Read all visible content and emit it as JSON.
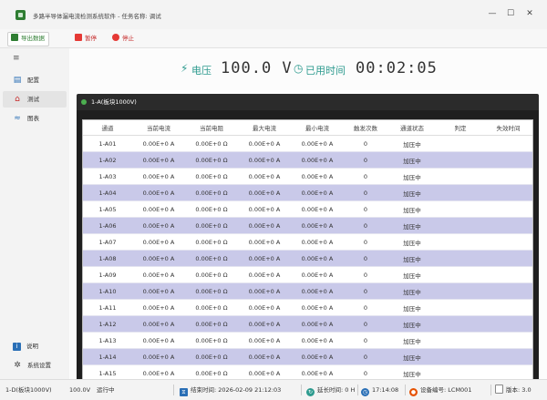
{
  "window": {
    "title": "多路半导体漏电流检测系统软件 - 任务名称: 调试",
    "minimize": "—",
    "maximize": "☐",
    "close": "✕"
  },
  "toolbar": {
    "export_label": "导出数据",
    "pause_label": "暂停",
    "stop_label": "停止"
  },
  "sidebar": {
    "items": [
      {
        "label": "配置",
        "icon": "config-icon"
      },
      {
        "label": "测试",
        "icon": "test-icon"
      },
      {
        "label": "图表",
        "icon": "chart-icon"
      }
    ],
    "bottom": [
      {
        "label": "说明",
        "icon": "info-icon"
      },
      {
        "label": "系统设置",
        "icon": "gear-icon"
      }
    ]
  },
  "metrics": {
    "voltage_label": "电压",
    "voltage_value": "100.0 V",
    "elapsed_label": "已用时间",
    "elapsed_value": "00:02:05"
  },
  "panel": {
    "title": "1-A(板块1000V)"
  },
  "table": {
    "columns": [
      "通道",
      "当前电流",
      "当前电阻",
      "最大电流",
      "最小电流",
      "触发次数",
      "通道状态",
      "判定",
      "失效时间"
    ],
    "rows": [
      [
        "1-A01",
        "0.00E+0 A",
        "0.00E+0 Ω",
        "0.00E+0 A",
        "0.00E+0 A",
        "0",
        "加压中",
        "",
        ""
      ],
      [
        "1-A02",
        "0.00E+0 A",
        "0.00E+0 Ω",
        "0.00E+0 A",
        "0.00E+0 A",
        "0",
        "加压中",
        "",
        ""
      ],
      [
        "1-A03",
        "0.00E+0 A",
        "0.00E+0 Ω",
        "0.00E+0 A",
        "0.00E+0 A",
        "0",
        "加压中",
        "",
        ""
      ],
      [
        "1-A04",
        "0.00E+0 A",
        "0.00E+0 Ω",
        "0.00E+0 A",
        "0.00E+0 A",
        "0",
        "加压中",
        "",
        ""
      ],
      [
        "1-A05",
        "0.00E+0 A",
        "0.00E+0 Ω",
        "0.00E+0 A",
        "0.00E+0 A",
        "0",
        "加压中",
        "",
        ""
      ],
      [
        "1-A06",
        "0.00E+0 A",
        "0.00E+0 Ω",
        "0.00E+0 A",
        "0.00E+0 A",
        "0",
        "加压中",
        "",
        ""
      ],
      [
        "1-A07",
        "0.00E+0 A",
        "0.00E+0 Ω",
        "0.00E+0 A",
        "0.00E+0 A",
        "0",
        "加压中",
        "",
        ""
      ],
      [
        "1-A08",
        "0.00E+0 A",
        "0.00E+0 Ω",
        "0.00E+0 A",
        "0.00E+0 A",
        "0",
        "加压中",
        "",
        ""
      ],
      [
        "1-A09",
        "0.00E+0 A",
        "0.00E+0 Ω",
        "0.00E+0 A",
        "0.00E+0 A",
        "0",
        "加压中",
        "",
        ""
      ],
      [
        "1-A10",
        "0.00E+0 A",
        "0.00E+0 Ω",
        "0.00E+0 A",
        "0.00E+0 A",
        "0",
        "加压中",
        "",
        ""
      ],
      [
        "1-A11",
        "0.00E+0 A",
        "0.00E+0 Ω",
        "0.00E+0 A",
        "0.00E+0 A",
        "0",
        "加压中",
        "",
        ""
      ],
      [
        "1-A12",
        "0.00E+0 A",
        "0.00E+0 Ω",
        "0.00E+0 A",
        "0.00E+0 A",
        "0",
        "加压中",
        "",
        ""
      ],
      [
        "1-A13",
        "0.00E+0 A",
        "0.00E+0 Ω",
        "0.00E+0 A",
        "0.00E+0 A",
        "0",
        "加压中",
        "",
        ""
      ],
      [
        "1-A14",
        "0.00E+0 A",
        "0.00E+0 Ω",
        "0.00E+0 A",
        "0.00E+0 A",
        "0",
        "加压中",
        "",
        ""
      ],
      [
        "1-A15",
        "0.00E+0 A",
        "0.00E+0 Ω",
        "0.00E+0 A",
        "0.00E+0 A",
        "0",
        "加压中",
        "",
        ""
      ],
      [
        "1-A16",
        "0.00E+0 A",
        "0.00E+0 Ω",
        "0.00E+0 A",
        "0.00E+0 A",
        "0",
        "加压中",
        "",
        ""
      ]
    ]
  },
  "statusbar": {
    "board": "1-D(板块1000V)",
    "voltage": "100.0V",
    "state": "运行中",
    "end_time_label": "结束时间:",
    "end_time": "2026-02-09 21:12:03",
    "duration_label": "延长时间:",
    "duration": "0 H",
    "clock": "17:14:08",
    "device_label": "设备编号:",
    "device_id": "LCM001",
    "version_label": "版本:",
    "version": "3.0"
  },
  "colors": {
    "accent": "#2e9b8f",
    "row_alt": "#c9c9e9",
    "panel_dark": "#2b2b2b",
    "status_green": "#4caf50"
  }
}
